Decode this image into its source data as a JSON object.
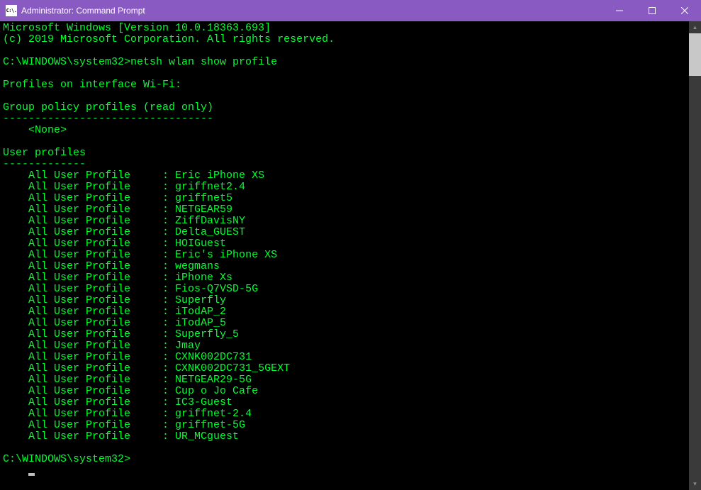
{
  "window": {
    "title": "Administrator: Command Prompt",
    "icon_label": "C:\\."
  },
  "terminal": {
    "version_line": "Microsoft Windows [Version 10.0.18363.693]",
    "copyright_line": "(c) 2019 Microsoft Corporation. All rights reserved.",
    "prompt": "C:\\WINDOWS\\system32>",
    "command": "netsh wlan show profile",
    "heading_interface": "Profiles on interface Wi-Fi:",
    "heading_group_policy": "Group policy profiles (read only)",
    "divider_group_policy": "---------------------------------",
    "none_label": "    <None>",
    "heading_user_profiles": "User profiles",
    "divider_user_profiles": "-------------",
    "profile_label": "    All User Profile     : ",
    "profiles": [
      "Eric iPhone XS",
      "griffnet2.4",
      "griffnet5",
      "NETGEAR59",
      "ZiffDavisNY",
      "Delta_GUEST",
      "HOIGuest",
      "Eric's iPhone XS",
      "wegmans",
      "iPhone Xs",
      "Fios-Q7VSD-5G",
      "Superfly",
      "iTodAP_2",
      "iTodAP_5",
      "Superfly_5",
      "Jmay",
      "CXNK002DC731",
      "CXNK002DC731_5GEXT",
      "NETGEAR29-5G",
      "Cup o Jo Cafe",
      "IC3-Guest",
      "griffnet-2.4",
      "griffnet-5G",
      "UR_MCguest"
    ],
    "final_prompt": "C:\\WINDOWS\\system32>"
  }
}
